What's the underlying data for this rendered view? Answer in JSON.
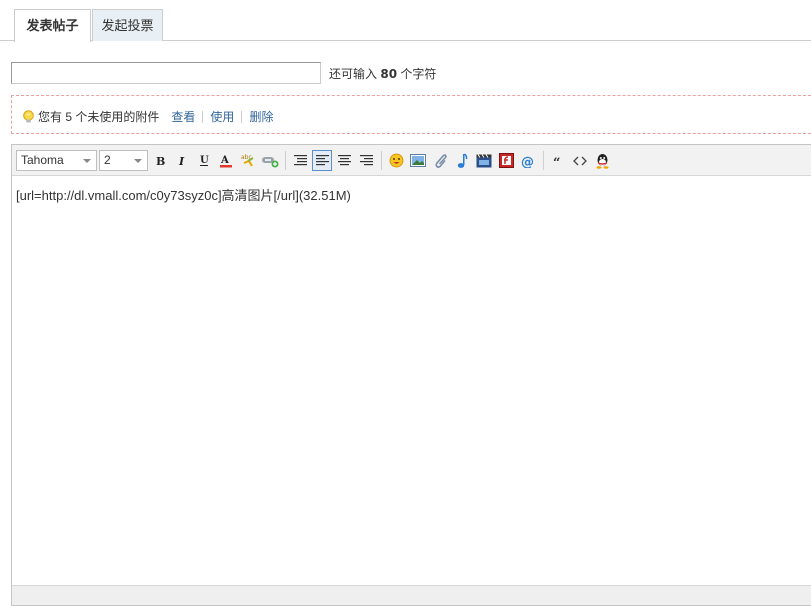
{
  "tabs": [
    {
      "label": "发表帖子",
      "active": true
    },
    {
      "label": "发起投票",
      "active": false
    }
  ],
  "subject": {
    "value": "",
    "remaining_prefix": "还可输入",
    "remaining_count": "80",
    "remaining_suffix": "个字符"
  },
  "attachments": {
    "notice_prefix": "您有",
    "count": "5",
    "notice_suffix": "个未使用的附件",
    "links": [
      "查看",
      "使用",
      "删除"
    ]
  },
  "toolbar": {
    "font": "Tahoma",
    "size": "2",
    "buttons": [
      "bold-icon",
      "italic-icon",
      "underline-icon",
      "font-color-icon",
      "spellcheck-icon",
      "link-icon",
      "align-left-icon",
      "align-justify-icon",
      "align-center-icon",
      "align-right-icon",
      "smiley-icon",
      "image-icon",
      "attachment-icon",
      "music-icon",
      "video-icon",
      "flash-icon",
      "mention-icon",
      "quote-icon",
      "code-icon",
      "qq-icon"
    ]
  },
  "editor": {
    "content": "[url=http://dl.vmall.com/c0y73syz0c]高清图片[/url](32.51M)"
  },
  "colors": {
    "link": "#336699",
    "tab_inactive_bg": "#e8eff5",
    "notice_border": "#e8a2a2",
    "toolbar_bg": "#f2f2f2"
  }
}
